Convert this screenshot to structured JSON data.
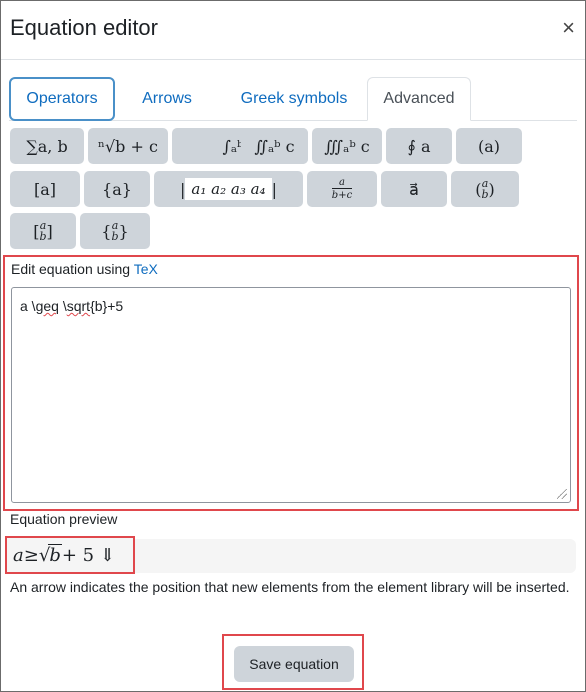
{
  "dialog": {
    "title": "Equation editor",
    "close_label": "×"
  },
  "tabs": [
    {
      "label": "Operators",
      "state": "focused"
    },
    {
      "label": "Arrows",
      "state": "normal"
    },
    {
      "label": "Greek symbols",
      "state": "normal"
    },
    {
      "label": "Advanced",
      "state": "active"
    }
  ],
  "palette": {
    "row1": {
      "sum": "∑a, b",
      "root": "ⁿ√b + c",
      "integral": "∫ₐᵇ c",
      "double_integral": "∬ₐᵇ c",
      "triple_integral": "∭ₐᵇ c",
      "contour_integral": "∮ a",
      "parentheses": "(a)"
    },
    "row2": {
      "brackets": "[a]",
      "braces": "{a}",
      "matrix": "a₁   a₂ a₃   a₄",
      "fraction_num": "a",
      "fraction_den": "b+c",
      "vector": "a⃗",
      "binomial_top": "a",
      "binomial_bottom": "b"
    },
    "row3": {
      "bracket_vec_top": "a",
      "bracket_vec_bottom": "b",
      "brace_vec_top": "a",
      "brace_vec_bottom": "b"
    }
  },
  "edit": {
    "label_prefix": "Edit equation using ",
    "label_link": "TeX",
    "tex_part1": "a \\",
    "tex_geq": "geq",
    "tex_space": " \\",
    "tex_sqrt": "sqrt",
    "tex_part2": "{b}+5"
  },
  "preview": {
    "label": "Equation preview",
    "math_a": "a",
    "math_geq": " ≥ ",
    "math_sqrt_sign": "√",
    "math_b": "b",
    "math_rest": " + 5 ⇓"
  },
  "help_text": "An arrow indicates the position that new elements from the element library will be inserted.",
  "save_label": "Save equation",
  "colors": {
    "highlight": "#e0474c",
    "link": "#0f6cbf",
    "button_bg": "#ced4da"
  }
}
